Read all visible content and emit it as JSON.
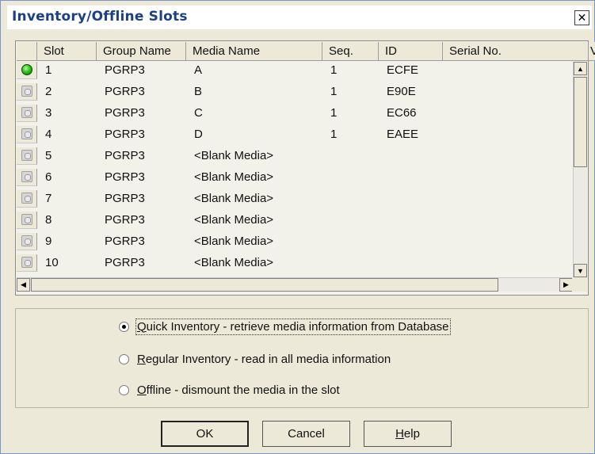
{
  "window": {
    "title": "Inventory/Offline Slots",
    "close_glyph": "✕"
  },
  "grid": {
    "columns": [
      "Slot",
      "Group Name",
      "Media Name",
      "Seq.",
      "ID",
      "Serial No.",
      "V"
    ],
    "rows": [
      {
        "slot": "1",
        "group": "PGRP3",
        "media": "A",
        "seq": "1",
        "id": "ECFE",
        "serial": "",
        "icon": "green"
      },
      {
        "slot": "2",
        "group": "PGRP3",
        "media": "B",
        "seq": "1",
        "id": "E90E",
        "serial": "",
        "icon": "gray"
      },
      {
        "slot": "3",
        "group": "PGRP3",
        "media": "C",
        "seq": "1",
        "id": "EC66",
        "serial": "",
        "icon": "gray"
      },
      {
        "slot": "4",
        "group": "PGRP3",
        "media": "D",
        "seq": "1",
        "id": "EAEE",
        "serial": "",
        "icon": "gray"
      },
      {
        "slot": "5",
        "group": "PGRP3",
        "media": "<Blank Media>",
        "seq": "",
        "id": "",
        "serial": "",
        "icon": "gray"
      },
      {
        "slot": "6",
        "group": "PGRP3",
        "media": "<Blank Media>",
        "seq": "",
        "id": "",
        "serial": "",
        "icon": "gray"
      },
      {
        "slot": "7",
        "group": "PGRP3",
        "media": "<Blank Media>",
        "seq": "",
        "id": "",
        "serial": "",
        "icon": "gray"
      },
      {
        "slot": "8",
        "group": "PGRP3",
        "media": "<Blank Media>",
        "seq": "",
        "id": "",
        "serial": "",
        "icon": "gray"
      },
      {
        "slot": "9",
        "group": "PGRP3",
        "media": "<Blank Media>",
        "seq": "",
        "id": "",
        "serial": "",
        "icon": "gray"
      },
      {
        "slot": "10",
        "group": "PGRP3",
        "media": "<Blank Media>",
        "seq": "",
        "id": "",
        "serial": "",
        "icon": "gray"
      }
    ],
    "scroll": {
      "up": "▲",
      "down": "▼",
      "left": "◀",
      "right": "▶"
    }
  },
  "options": [
    {
      "key": "Q",
      "rest": "uick Inventory - retrieve media information from Database",
      "checked": true
    },
    {
      "key": "R",
      "rest": "egular Inventory - read in all media information",
      "checked": false
    },
    {
      "key": "O",
      "rest": "ffline - dismount the media in the slot",
      "checked": false
    }
  ],
  "buttons": {
    "ok": "OK",
    "cancel": "Cancel",
    "help_key": "H",
    "help_rest": "elp"
  },
  "colors": {
    "status_ok": "#31c320",
    "title_text": "#1c3f86",
    "dialog_bg": "#ECE9D8"
  }
}
